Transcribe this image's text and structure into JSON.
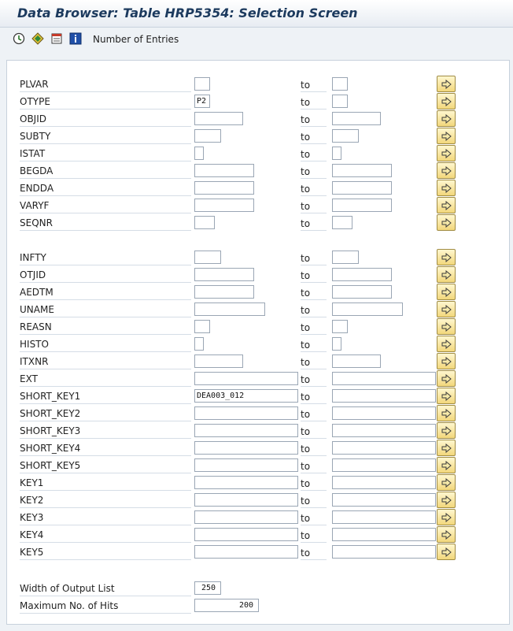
{
  "window": {
    "title": "Data Browser: Table HRP5354: Selection Screen"
  },
  "toolbar": {
    "icons": [
      "execute-icon",
      "selection-options-icon",
      "selection-fields-icon",
      "info-icon"
    ],
    "number_of_entries_label": "Number of Entries"
  },
  "form": {
    "to_label": "to",
    "fields": [
      {
        "label": "PLVAR",
        "from": "",
        "to": ""
      },
      {
        "label": "OTYPE",
        "from": "P2",
        "to": ""
      },
      {
        "label": "OBJID",
        "from": "",
        "to": ""
      },
      {
        "label": "SUBTY",
        "from": "",
        "to": ""
      },
      {
        "label": "ISTAT",
        "from": "",
        "to": ""
      },
      {
        "label": "BEGDA",
        "from": "",
        "to": ""
      },
      {
        "label": "ENDDA",
        "from": "",
        "to": ""
      },
      {
        "label": "VARYF",
        "from": "",
        "to": ""
      },
      {
        "label": "SEQNR",
        "from": "",
        "to": ""
      },
      {
        "label": "INFTY",
        "from": "",
        "to": ""
      },
      {
        "label": "OTJID",
        "from": "",
        "to": ""
      },
      {
        "label": "AEDTM",
        "from": "",
        "to": ""
      },
      {
        "label": "UNAME",
        "from": "",
        "to": ""
      },
      {
        "label": "REASN",
        "from": "",
        "to": ""
      },
      {
        "label": "HISTO",
        "from": "",
        "to": ""
      },
      {
        "label": "ITXNR",
        "from": "",
        "to": ""
      },
      {
        "label": "EXT",
        "from": "",
        "to": ""
      },
      {
        "label": "SHORT_KEY1",
        "from": "DEA003_012",
        "to": ""
      },
      {
        "label": "SHORT_KEY2",
        "from": "",
        "to": ""
      },
      {
        "label": "SHORT_KEY3",
        "from": "",
        "to": ""
      },
      {
        "label": "SHORT_KEY4",
        "from": "",
        "to": ""
      },
      {
        "label": "SHORT_KEY5",
        "from": "",
        "to": ""
      },
      {
        "label": "KEY1",
        "from": "",
        "to": ""
      },
      {
        "label": "KEY2",
        "from": "",
        "to": ""
      },
      {
        "label": "KEY3",
        "from": "",
        "to": ""
      },
      {
        "label": "KEY4",
        "from": "",
        "to": ""
      },
      {
        "label": "KEY5",
        "from": "",
        "to": ""
      }
    ]
  },
  "output": {
    "width_label": "Width of Output List",
    "width_value": "250",
    "max_hits_label": "Maximum No. of Hits",
    "max_hits_value": "200"
  },
  "colors": {
    "title": "#1c3a5e",
    "arrow_button": "#f2d77c",
    "background": "#eef2f6"
  }
}
